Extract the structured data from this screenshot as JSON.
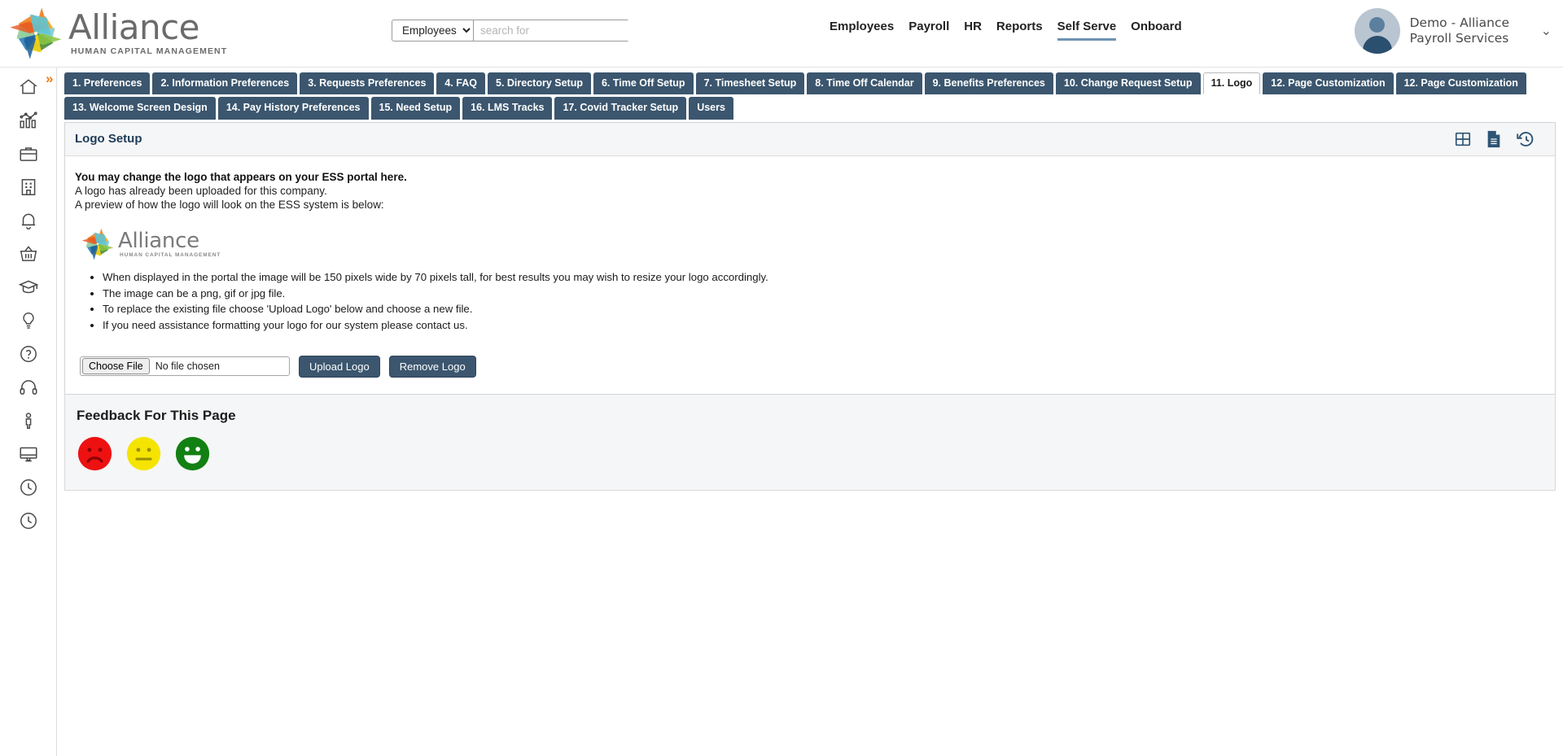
{
  "brand": {
    "name": "Alliance",
    "tagline": "HUMAN CAPITAL MANAGEMENT"
  },
  "search": {
    "scope_selected": "Employees",
    "scope_options": [
      "Employees"
    ],
    "placeholder": "search for",
    "value": ""
  },
  "main_nav": [
    {
      "label": "Employees",
      "active": false
    },
    {
      "label": "Payroll",
      "active": false
    },
    {
      "label": "HR",
      "active": false
    },
    {
      "label": "Reports",
      "active": false
    },
    {
      "label": "Self Serve",
      "active": true
    },
    {
      "label": "Onboard",
      "active": false
    }
  ],
  "user": {
    "name": "Demo - Alliance Payroll Services",
    "chevron": "chevron-down-icon"
  },
  "sidebar": {
    "expander": "»",
    "items": [
      {
        "icon": "home-icon"
      },
      {
        "icon": "analytics-chart-icon"
      },
      {
        "icon": "briefcase-icon"
      },
      {
        "icon": "building-icon"
      },
      {
        "icon": "bell-icon"
      },
      {
        "icon": "basket-icon"
      },
      {
        "icon": "graduation-cap-icon"
      },
      {
        "icon": "lightbulb-icon"
      },
      {
        "icon": "help-circle-icon"
      },
      {
        "icon": "headset-icon"
      },
      {
        "icon": "person-icon"
      },
      {
        "icon": "monitor-icon"
      },
      {
        "icon": "clock-icon"
      },
      {
        "icon": "clock-history-icon"
      }
    ]
  },
  "tabs": {
    "row1": [
      {
        "label": "1. Preferences",
        "active": false
      },
      {
        "label": "2. Information Preferences",
        "active": false
      },
      {
        "label": "3. Requests Preferences",
        "active": false
      },
      {
        "label": "4. FAQ",
        "active": false
      },
      {
        "label": "5. Directory Setup",
        "active": false
      },
      {
        "label": "6. Time Off Setup",
        "active": false
      },
      {
        "label": "7. Timesheet Setup",
        "active": false
      },
      {
        "label": "8. Time Off Calendar",
        "active": false
      },
      {
        "label": "9. Benefits Preferences",
        "active": false
      },
      {
        "label": "10. Change Request Setup",
        "active": false
      },
      {
        "label": "11. Logo",
        "active": true
      },
      {
        "label": "12. Page Customization",
        "active": false
      },
      {
        "label": "12. Page Customization",
        "active": false
      }
    ],
    "row2": [
      {
        "label": "13. Welcome Screen Design",
        "active": false
      },
      {
        "label": "14. Pay History Preferences",
        "active": false
      },
      {
        "label": "15. Need Setup",
        "active": false
      },
      {
        "label": "16. LMS Tracks",
        "active": false
      },
      {
        "label": "17. Covid Tracker Setup",
        "active": false
      },
      {
        "label": "Users",
        "active": false
      }
    ]
  },
  "panel": {
    "title": "Logo Setup",
    "actions": [
      {
        "icon": "grid-table-icon"
      },
      {
        "icon": "document-icon"
      },
      {
        "icon": "history-icon"
      }
    ],
    "lead": "You may change the logo that appears on your ESS portal here.",
    "line2": "A logo has already been uploaded for this company.",
    "line3": "A preview of how the logo will look on the ESS system is below:",
    "preview": {
      "name": "Alliance",
      "tagline": "HUMAN CAPITAL MANAGEMENT"
    },
    "notes": [
      "When displayed in the portal the image will be 150 pixels wide by 70 pixels tall, for best results you may wish to resize your logo accordingly.",
      "The image can be a png, gif or jpg file.",
      "To replace the existing file choose 'Upload Logo' below and choose a new file.",
      "If you need assistance formatting your logo for our system please contact us."
    ],
    "file_button_label": "Choose File",
    "file_name_text": "No file chosen",
    "upload_button": "Upload Logo",
    "remove_button": "Remove Logo"
  },
  "feedback": {
    "title": "Feedback For This Page",
    "options": [
      {
        "name": "sad-face-icon",
        "color": "#ee1111"
      },
      {
        "name": "neutral-face-icon",
        "color": "#f5e400"
      },
      {
        "name": "happy-face-icon",
        "color": "#128012"
      }
    ]
  },
  "colors": {
    "tab_blue": "#3b566e",
    "accent_orange": "#f07d1a",
    "nav_underline": "#6f93b3",
    "panel_title": "#1f3b57"
  }
}
